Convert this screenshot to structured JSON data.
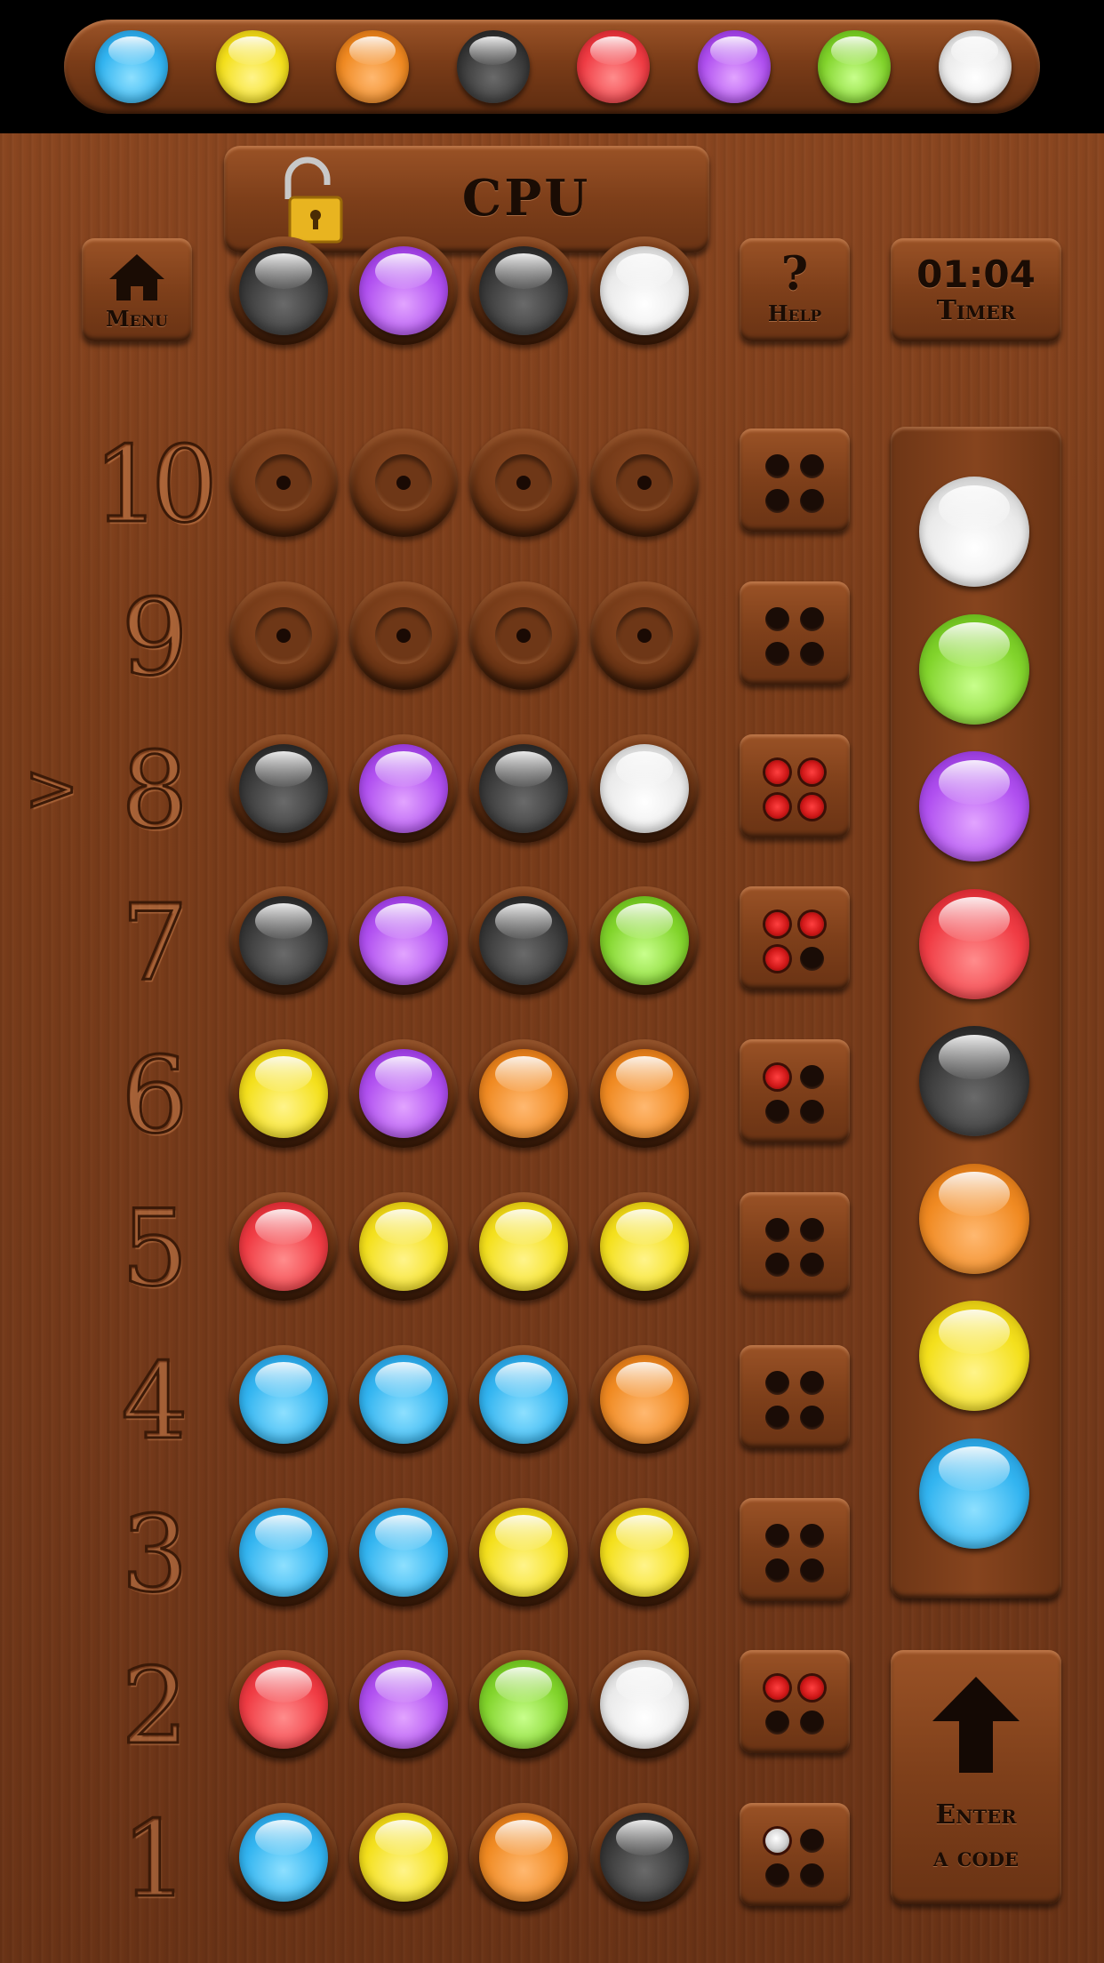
{
  "colors": {
    "blue": "#32b4f0",
    "yellow": "#f4e01c",
    "orange": "#f08a22",
    "black": "#3a3a3a",
    "red": "#f03c44",
    "purple": "#b050f0",
    "green": "#82d42c",
    "white": "#eaeaea"
  },
  "color_tray": [
    "blue",
    "yellow",
    "orange",
    "black",
    "red",
    "purple",
    "green",
    "white"
  ],
  "header": {
    "opponent_label": "CPU",
    "lock_icon": "unlocked-padlock-icon"
  },
  "menu_button": {
    "label": "Menu",
    "icon": "home-icon"
  },
  "help_button": {
    "symbol": "?",
    "label": "Help"
  },
  "timer": {
    "value": "01:04",
    "label": "Timer"
  },
  "secret_code": [
    "black",
    "purple",
    "black",
    "white"
  ],
  "current_row": 8,
  "current_row_marker": ">",
  "rows": [
    {
      "number": "10",
      "pegs": [
        null,
        null,
        null,
        null
      ],
      "feedback": {
        "exact": 0,
        "partial": 0
      }
    },
    {
      "number": "9",
      "pegs": [
        null,
        null,
        null,
        null
      ],
      "feedback": {
        "exact": 0,
        "partial": 0
      }
    },
    {
      "number": "8",
      "pegs": [
        "black",
        "purple",
        "black",
        "white"
      ],
      "feedback": {
        "exact": 4,
        "partial": 0
      }
    },
    {
      "number": "7",
      "pegs": [
        "black",
        "purple",
        "black",
        "green"
      ],
      "feedback": {
        "exact": 3,
        "partial": 0
      }
    },
    {
      "number": "6",
      "pegs": [
        "yellow",
        "purple",
        "orange",
        "orange"
      ],
      "feedback": {
        "exact": 1,
        "partial": 0
      }
    },
    {
      "number": "5",
      "pegs": [
        "red",
        "yellow",
        "yellow",
        "yellow"
      ],
      "feedback": {
        "exact": 0,
        "partial": 0
      }
    },
    {
      "number": "4",
      "pegs": [
        "blue",
        "blue",
        "blue",
        "orange"
      ],
      "feedback": {
        "exact": 0,
        "partial": 0
      }
    },
    {
      "number": "3",
      "pegs": [
        "blue",
        "blue",
        "yellow",
        "yellow"
      ],
      "feedback": {
        "exact": 0,
        "partial": 0
      }
    },
    {
      "number": "2",
      "pegs": [
        "red",
        "purple",
        "green",
        "white"
      ],
      "feedback": {
        "exact": 2,
        "partial": 0
      }
    },
    {
      "number": "1",
      "pegs": [
        "blue",
        "yellow",
        "orange",
        "black"
      ],
      "feedback": {
        "exact": 0,
        "partial": 1
      }
    }
  ],
  "palette": [
    "white",
    "green",
    "purple",
    "red",
    "black",
    "orange",
    "yellow",
    "blue"
  ],
  "enter_button": {
    "line1": "Enter",
    "line2": "a code",
    "icon": "up-arrow-icon"
  }
}
